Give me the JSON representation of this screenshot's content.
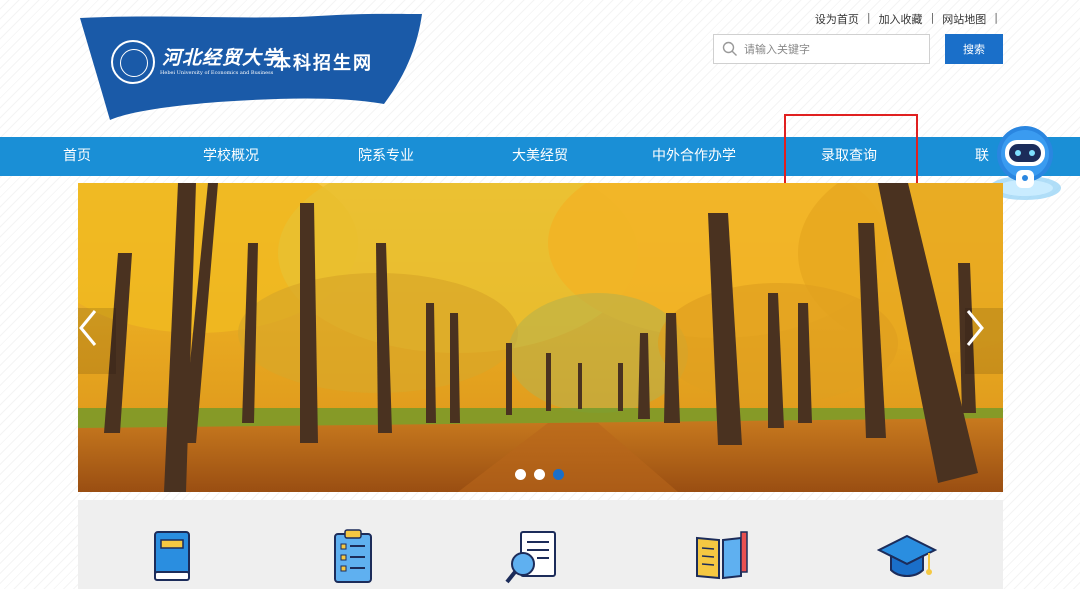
{
  "header": {
    "logo_cn": "河北经贸大学",
    "logo_en": "Hebei University of Economics and Business",
    "logo_site": "本科招生网",
    "top_links": [
      "设为首页",
      "加入收藏",
      "网站地图"
    ],
    "search_placeholder": "请输入关键字",
    "search_button": "搜索"
  },
  "nav": {
    "items": [
      "首页",
      "学校概况",
      "院系专业",
      "大美经贸",
      "中外合作办学",
      "录取查询",
      "联"
    ],
    "highlighted": "录取查询"
  },
  "banner": {
    "slide_count": 3,
    "active_slide": 3
  },
  "features": {
    "icons": [
      "book-icon",
      "clipboard-icon",
      "document-search-icon",
      "open-book-icon",
      "graduation-cap-icon"
    ]
  },
  "colors": {
    "nav_blue": "#1a8fd6",
    "button_blue": "#1a6fc9",
    "logo_blue": "#1a5aa8",
    "highlight_red": "#e02020"
  }
}
